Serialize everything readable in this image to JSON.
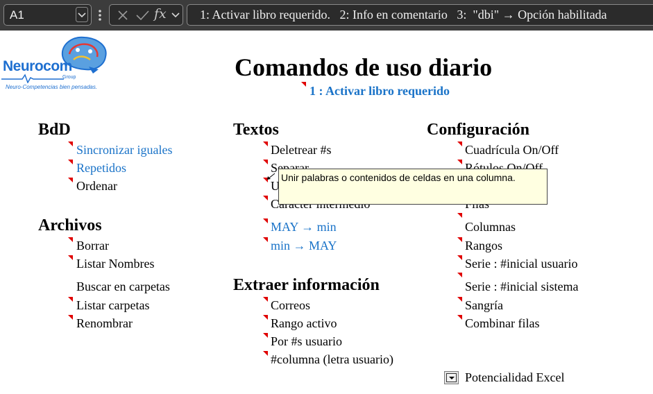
{
  "formula_bar": {
    "name_box": "A1",
    "fx_label": "fx",
    "formula": "1: Activar libro requerido.   2: Info en comentario   3:  \"dbi\" → Opción habilitada"
  },
  "logo": {
    "brand": "Neurocom",
    "group": "Group",
    "tagline": "Neuro-Competencias bien pensadas.",
    "colors": {
      "primary": "#1e6fd0",
      "secondary": "#e53935"
    }
  },
  "title": "Comandos de uso diario",
  "subtitle": "1 : Activar libro requerido",
  "sections": {
    "bdd": {
      "heading": "BdD",
      "items": [
        "Sincronizar iguales",
        "Repetidos",
        "Ordenar"
      ]
    },
    "archivos": {
      "heading": "Archivos",
      "items": [
        "Borrar",
        "Listar Nombres",
        "Buscar en carpetas",
        "Listar carpetas",
        "Renombrar"
      ]
    },
    "textos": {
      "heading": "Textos",
      "items": [
        "Deletrear #s",
        "Separar",
        "Unir",
        "Carácter intermedio",
        "MAY → min",
        "min → MAY"
      ]
    },
    "extraer": {
      "heading": "Extraer información",
      "items": [
        "Correos",
        "Rango activo",
        "Por #s usuario",
        "#columna (letra usuario)"
      ]
    },
    "configuracion": {
      "heading": "Configuración",
      "items": [
        "Cuadrícula On/Off",
        "Rótulos On/Off",
        "Filas",
        "Columnas",
        "Rangos",
        "Serie : #inicial usuario",
        "Serie : #inicial sistema",
        "Sangría",
        "Combinar filas"
      ]
    }
  },
  "tooltip": "Unir palabras o contenidos de celdas en una columna.",
  "footer": {
    "label": "Potencialidad Excel"
  },
  "colors": {
    "link": "#1a73c8",
    "comment_marker": "#e00000",
    "tooltip_bg": "#ffffe1",
    "formula_bar_bg": "#3c3c3c"
  }
}
